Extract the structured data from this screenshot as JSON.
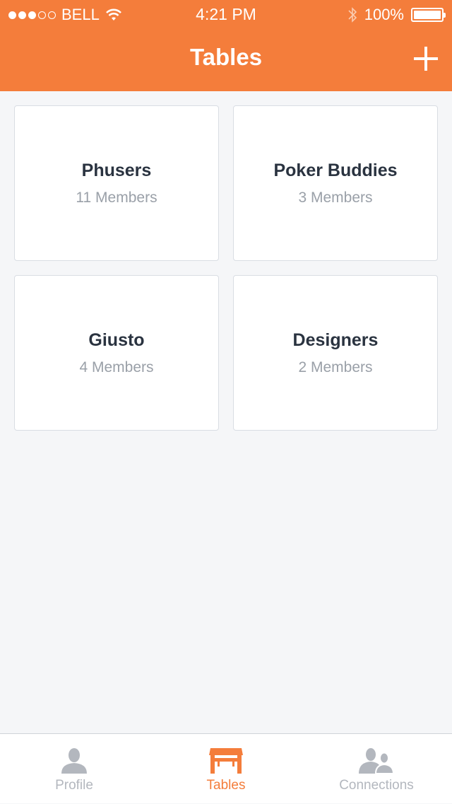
{
  "status_bar": {
    "carrier": "BELL",
    "time": "4:21 PM",
    "battery": "100%",
    "signal_filled": 3,
    "signal_total": 5
  },
  "nav": {
    "title": "Tables",
    "add_icon": "plus-icon"
  },
  "tables": [
    {
      "name": "Phusers",
      "members": "11 Members"
    },
    {
      "name": "Poker Buddies",
      "members": "3 Members"
    },
    {
      "name": "Giusto",
      "members": "4 Members"
    },
    {
      "name": "Designers",
      "members": "2 Members"
    }
  ],
  "tabs": [
    {
      "label": "Profile",
      "icon": "person-icon",
      "active": false
    },
    {
      "label": "Tables",
      "icon": "table-icon",
      "active": true
    },
    {
      "label": "Connections",
      "icon": "people-icon",
      "active": false
    }
  ],
  "colors": {
    "accent": "#f47d3b",
    "inactive": "#b3b7be",
    "card_title": "#2a3340",
    "card_sub": "#9aa0a8",
    "background": "#f5f6f8"
  }
}
